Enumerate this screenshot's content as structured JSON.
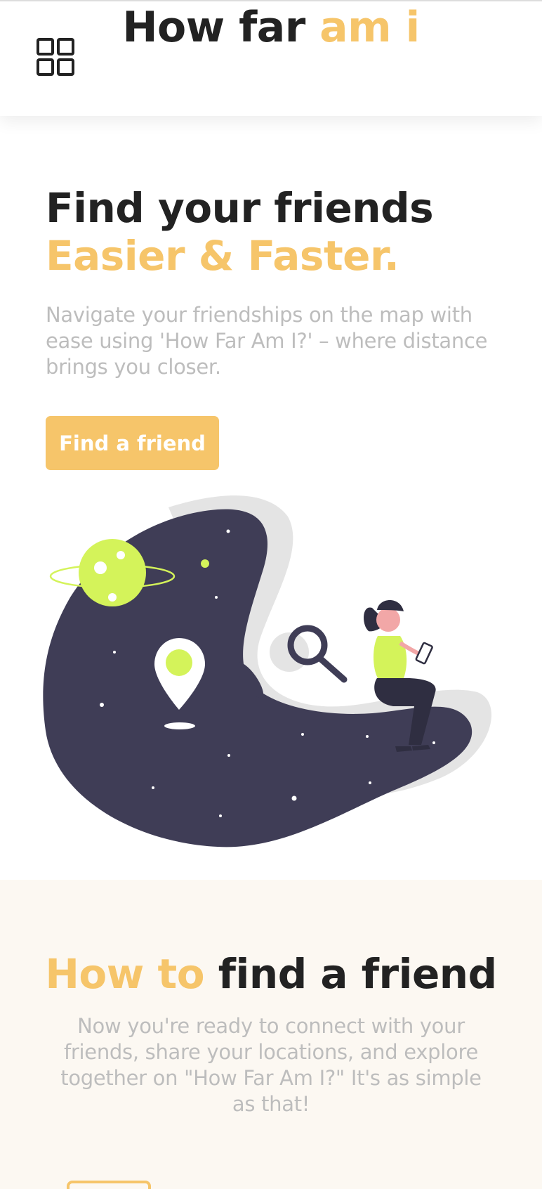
{
  "header": {
    "brand_part1": "How far ",
    "brand_part2": "am i",
    "menu_icon": "grid-menu-icon"
  },
  "hero": {
    "title_line1": "Find your friends",
    "title_line2": "Easier & Faster.",
    "description": "Navigate your friendships on the map with ease using 'How Far Am I?' – where distance brings you closer.",
    "cta_label": "Find a friend"
  },
  "howto": {
    "title_part1": "How to",
    "title_part2": " find a friend",
    "description": "Now you're ready to connect with your friends, share your locations, and explore together on \"How Far Am I?\" It's as simple as that!"
  },
  "colors": {
    "accent": "#f6c56a",
    "text_dark": "#222222",
    "text_muted": "#bdbdbd",
    "illustration_dark": "#3f3d56",
    "illustration_lime": "#d4f35a",
    "section_bg": "#fcf8f2"
  }
}
